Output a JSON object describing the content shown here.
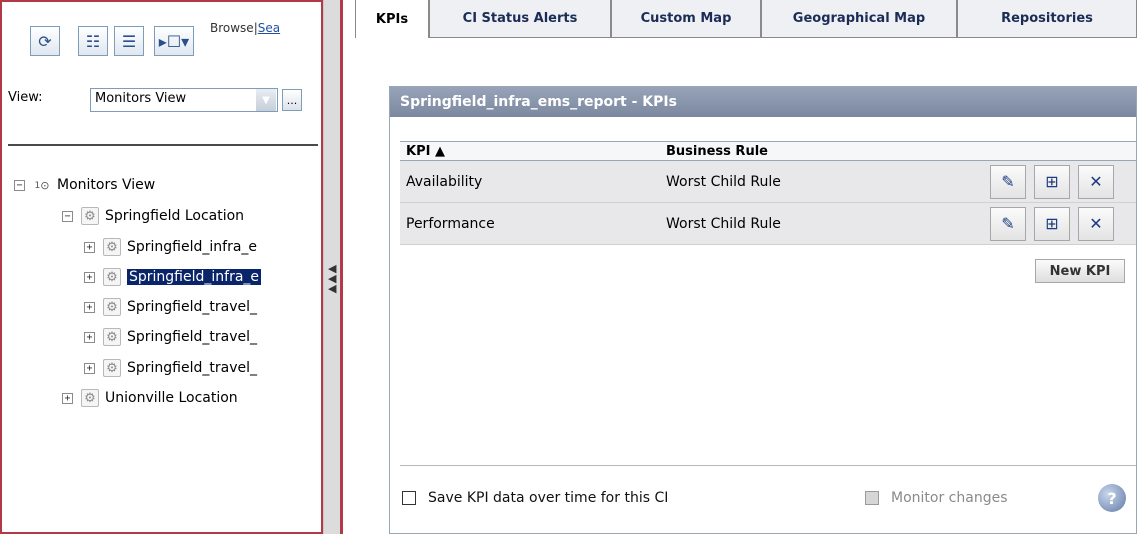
{
  "toolbar": {
    "refresh_icon": "refresh-icon",
    "tree_view_icon": "tree-view-icon",
    "list_view_icon": "list-view-icon",
    "select_mode_icon": "select-mode-icon",
    "browse_label": "Browse",
    "separator": "|",
    "search_label": "Sea"
  },
  "view": {
    "label": "View:",
    "selected": "Monitors View",
    "more_label": "..."
  },
  "tree": {
    "root": {
      "label": "Monitors View",
      "expander": "−",
      "badge": "1"
    },
    "nodes": [
      {
        "label": "Springfield Location",
        "expander": "−",
        "depth": 1
      },
      {
        "label": "Springfield_infra_e",
        "expander": "+",
        "depth": 2
      },
      {
        "label": "Springfield_infra_e",
        "expander": "+",
        "depth": 2,
        "selected": true
      },
      {
        "label": "Springfield_travel_",
        "expander": "+",
        "depth": 2
      },
      {
        "label": "Springfield_travel_",
        "expander": "+",
        "depth": 2
      },
      {
        "label": "Springfield_travel_",
        "expander": "+",
        "depth": 2
      },
      {
        "label": "Unionville Location",
        "expander": "+",
        "depth": 1
      }
    ]
  },
  "tabs": [
    {
      "label": "KPIs",
      "active": true
    },
    {
      "label": "CI Status Alerts",
      "active": false
    },
    {
      "label": "Custom Map",
      "active": false
    },
    {
      "label": "Geographical Map",
      "active": false
    },
    {
      "label": "Repositories",
      "active": false
    }
  ],
  "kpi_panel": {
    "title": "Springfield_infra_ems_report - KPIs",
    "col_kpi": "KPI ▲",
    "col_rule": "Business Rule",
    "rows": [
      {
        "kpi": "Availability",
        "rule": "Worst Child Rule"
      },
      {
        "kpi": "Performance",
        "rule": "Worst Child Rule"
      }
    ],
    "new_kpi_label": "New KPI",
    "save_kpi_label": "Save KPI data over time for this CI",
    "monitor_changes_label": "Monitor changes",
    "help_label": "?"
  },
  "colors": {
    "selection": "#0a246a",
    "panel_border": "#b23a48",
    "title_bar": "#8b97ad"
  }
}
